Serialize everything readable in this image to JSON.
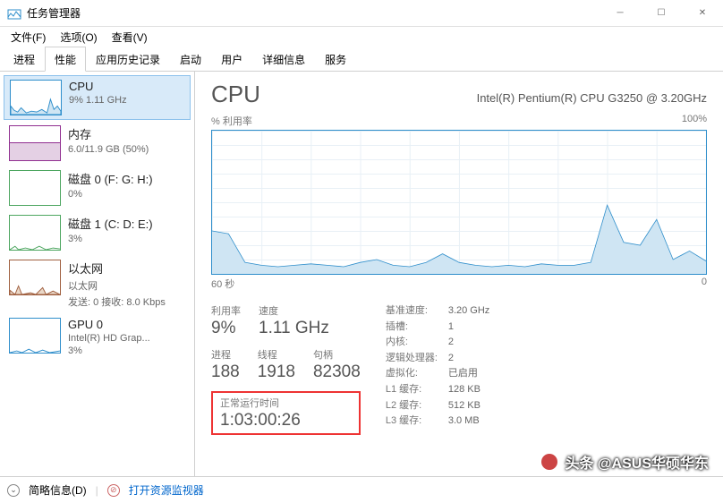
{
  "window": {
    "title": "任务管理器"
  },
  "menu": {
    "file": "文件(F)",
    "options": "选项(O)",
    "view": "查看(V)"
  },
  "tabs": {
    "processes": "进程",
    "performance": "性能",
    "history": "应用历史记录",
    "startup": "启动",
    "users": "用户",
    "details": "详细信息",
    "services": "服务"
  },
  "sidebar": [
    {
      "name": "CPU",
      "stat": "9% 1.11 GHz",
      "color": "#2E8ECB"
    },
    {
      "name": "内存",
      "stat": "6.0/11.9 GB (50%)",
      "color": "#902F90"
    },
    {
      "name": "磁盘 0 (F: G: H:)",
      "stat": "0%",
      "color": "#4DA660"
    },
    {
      "name": "磁盘 1 (C: D: E:)",
      "stat": "3%",
      "color": "#4DA660"
    },
    {
      "name": "以太网",
      "stat": "以太网",
      "stat2": "发送: 0 接收: 8.0 Kbps",
      "color": "#A06040"
    },
    {
      "name": "GPU 0",
      "stat": "Intel(R) HD Grap...",
      "stat2": "3%",
      "color": "#2E8ECB"
    }
  ],
  "detail": {
    "title": "CPU",
    "sub": "Intel(R) Pentium(R) CPU G3250 @ 3.20GHz",
    "chart_ylabel": "% 利用率",
    "chart_ymax": "100%",
    "chart_xleft": "60 秒",
    "chart_xright": "0",
    "util_lbl": "利用率",
    "util_val": "9%",
    "speed_lbl": "速度",
    "speed_val": "1.11 GHz",
    "proc_lbl": "进程",
    "proc_val": "188",
    "thread_lbl": "线程",
    "thread_val": "1918",
    "handle_lbl": "句柄",
    "handle_val": "82308",
    "uptime_lbl": "正常运行时间",
    "uptime_val": "1:03:00:26",
    "info": {
      "base_k": "基准速度:",
      "base_v": "3.20 GHz",
      "sock_k": "插槽:",
      "sock_v": "1",
      "core_k": "内核:",
      "core_v": "2",
      "lp_k": "逻辑处理器:",
      "lp_v": "2",
      "virt_k": "虚拟化:",
      "virt_v": "已启用",
      "l1_k": "L1 缓存:",
      "l1_v": "128 KB",
      "l2_k": "L2 缓存:",
      "l2_v": "512 KB",
      "l3_k": "L3 缓存:",
      "l3_v": "3.0 MB"
    }
  },
  "footer": {
    "simple": "简略信息(D)",
    "resmon": "打开资源监视器"
  },
  "watermark": "头条 @ASUS华硕华东",
  "chart_data": {
    "type": "line",
    "title": "% 利用率",
    "xlabel": "秒",
    "ylabel": "%",
    "ylim": [
      0,
      100
    ],
    "xlim": [
      60,
      0
    ],
    "x": [
      60,
      58,
      56,
      54,
      52,
      50,
      48,
      46,
      44,
      42,
      40,
      38,
      36,
      34,
      32,
      30,
      28,
      26,
      24,
      22,
      20,
      18,
      16,
      14,
      12,
      10,
      8,
      6,
      4,
      2,
      0
    ],
    "values": [
      30,
      28,
      8,
      6,
      5,
      6,
      7,
      6,
      5,
      8,
      10,
      6,
      5,
      8,
      14,
      8,
      6,
      5,
      6,
      5,
      7,
      6,
      6,
      8,
      48,
      22,
      20,
      38,
      10,
      16,
      9
    ]
  }
}
